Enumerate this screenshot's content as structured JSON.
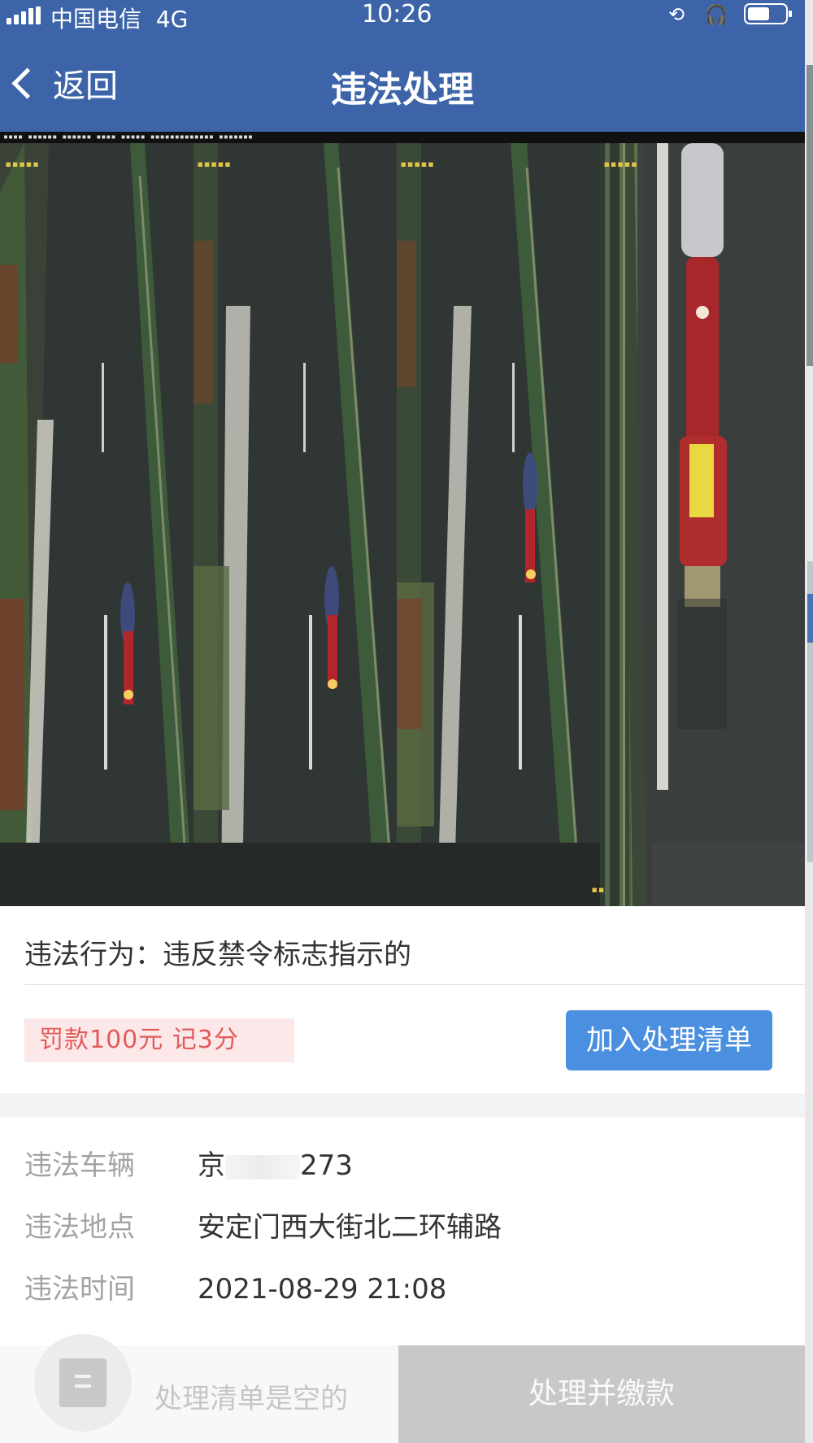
{
  "status_bar": {
    "carrier": "中国电信",
    "network": "4G",
    "time": "10:26",
    "icons": [
      "signal-icon",
      "rotation-lock-icon",
      "headphones-icon",
      "battery-icon"
    ]
  },
  "nav": {
    "back_label": "返回",
    "title": "违法处理"
  },
  "photo": {
    "frame_count": 4,
    "icons": [
      "traffic-camera-photo"
    ]
  },
  "violation": {
    "behavior": "违法行为：违反禁令标志指示的",
    "penalty": "罚款100元  记3分",
    "add_button": "加入处理清单"
  },
  "details": [
    {
      "key": "违法车辆",
      "value_prefix": "京",
      "value_suffix": "273"
    },
    {
      "key": "违法地点",
      "value": "安定门西大街北二环辅路"
    },
    {
      "key": "违法时间",
      "value": "2021-08-29 21:08"
    }
  ],
  "bottom_bar": {
    "empty_text": "处理清单是空的",
    "pay_button": "处理并缴款"
  },
  "colors": {
    "header_blue": "#3d64a8",
    "button_blue": "#4a8fe0",
    "penalty_red": "#e35a5a",
    "penalty_bg": "#fce8e8",
    "disabled_gray": "#c8c8c8"
  }
}
